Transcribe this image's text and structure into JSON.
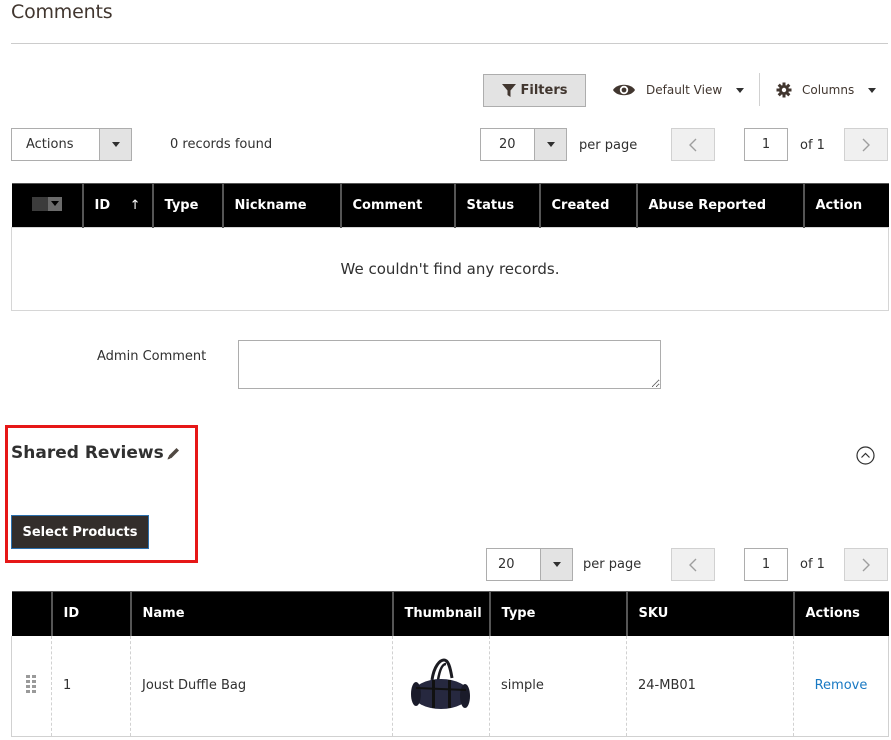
{
  "comments": {
    "title": "Comments",
    "toolbar": {
      "filters_label": "Filters",
      "view_label": "Default View",
      "columns_label": "Columns"
    },
    "actions_label": "Actions",
    "records_found": "0 records found",
    "pager": {
      "per_page_value": "20",
      "per_page_label": "per page",
      "current_page": "1",
      "of_label": "of 1"
    },
    "columns": [
      "ID",
      "Type",
      "Nickname",
      "Comment",
      "Status",
      "Created",
      "Abuse Reported",
      "Action"
    ],
    "sort_indicator": "↑",
    "empty_message": "We couldn't find any records.",
    "admin_comment_label": "Admin Comment",
    "admin_comment_value": ""
  },
  "shared_reviews": {
    "title": "Shared Reviews",
    "select_products_label": "Select Products",
    "highlight_color": "#e61717",
    "pager": {
      "per_page_value": "20",
      "per_page_label": "per page",
      "current_page": "1",
      "of_label": "of 1"
    },
    "columns": [
      "ID",
      "Name",
      "Thumbnail",
      "Type",
      "SKU",
      "Actions"
    ],
    "rows": [
      {
        "id": "1",
        "name": "Joust Duffle Bag",
        "thumbnail": "duffle-bag-image",
        "type": "simple",
        "sku": "24-MB01",
        "action_label": "Remove"
      }
    ]
  },
  "colors": {
    "header_bg": "#000000",
    "button_dark": "#332e2b",
    "link": "#1979c3",
    "title": "#41362f"
  }
}
